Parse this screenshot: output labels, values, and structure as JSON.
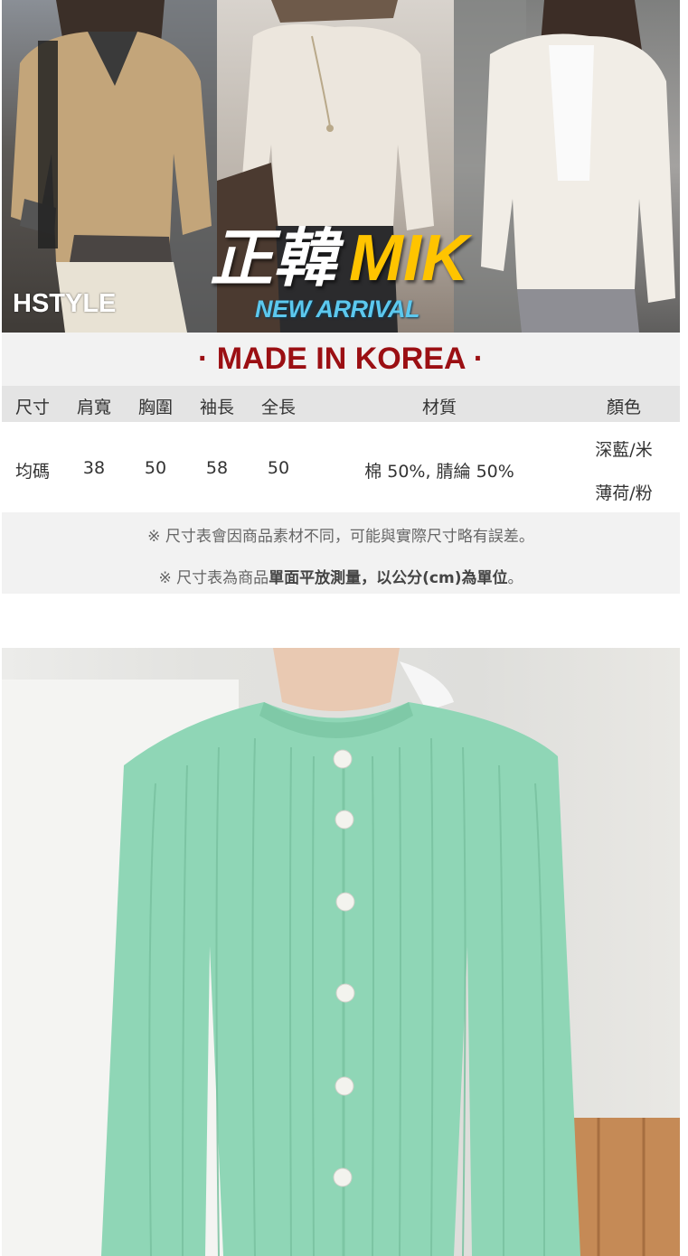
{
  "banner": {
    "watermark": "HSTYLE",
    "brand_zh": "正韓",
    "brand_en": "MIK",
    "tagline": "NEW ARRIVAL"
  },
  "made_in": "· MADE IN KOREA ·",
  "size_table": {
    "headers": [
      "尺寸",
      "肩寬",
      "胸圍",
      "袖長",
      "全長",
      "材質",
      "顏色"
    ],
    "row": {
      "size": "均碼",
      "shoulder": "38",
      "chest": "50",
      "sleeve": "58",
      "length": "50",
      "material": "棉 50%, 腈綸 50%",
      "colors": [
        "深藍/米",
        "薄荷/粉"
      ]
    }
  },
  "notes": {
    "note1": "※ 尺寸表會因商品素材不同，可能與實際尺寸略有誤差。",
    "note2_prefix": "※ 尺寸表為商品",
    "note2_bold": "單面平放測量，以公分(cm)為單位",
    "note2_suffix": "。"
  },
  "colors": {
    "made_in_red": "#9b0f13",
    "brand_yellow": "#ffc400",
    "tagline_blue": "#5cc8ee",
    "product_mint": "#8fd6b6"
  }
}
